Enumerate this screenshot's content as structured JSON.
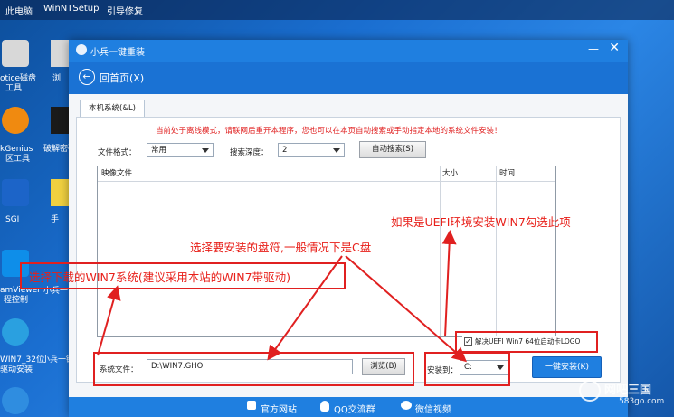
{
  "desktop": {
    "top_items": [
      "此电脑",
      "WinNTSetup",
      "引导修复"
    ],
    "icons": [
      {
        "label1": "otice磁盘",
        "label2": "工具",
        "icon": "disk-tool-icon",
        "color": "#cfcfcf"
      },
      {
        "label1": "kGenius",
        "label2": "区工具",
        "icon": "diskgenius-icon",
        "color": "#f08a10"
      },
      {
        "label1": "SGI",
        "label2": "",
        "icon": "sgi-icon",
        "color": "#1c64c8"
      },
      {
        "label1": "amViewer",
        "label2": "程控制",
        "icon": "teamviewer-icon",
        "color": "#0e8ee9"
      },
      {
        "label1": "WIN7_32位",
        "label2": "驱动安装",
        "icon": "driver-install-icon",
        "color": "#2aa0e0"
      },
      {
        "label1": "",
        "label2": "",
        "icon": "gear-tool-icon",
        "color": "#2f8de0"
      }
    ],
    "col2_labels": [
      "浏",
      "破解密码",
      "手",
      "小兵一",
      "小兵一键"
    ]
  },
  "window": {
    "title": "小兵一键重装",
    "back_label": "回首页(X)",
    "tab_label": "本机系统(&L)",
    "notice": "当前处于离线模式，请联网后重开本程序，您也可以在本页自动搜索或手动指定本地的系统文件安装！",
    "file_format_label": "文件格式：",
    "file_format_value": "常用",
    "search_depth_label": "搜索深度：",
    "search_depth_value": "2",
    "auto_search_button": "自动搜索(S)",
    "columns": [
      "映像文件",
      "大小",
      "时间"
    ],
    "uefi_checkbox_label": "解决UEFI Win7 64位启动卡LOGO",
    "system_file_label": "系统文件：",
    "system_file_value": "D:\\WIN7.GHO",
    "browse_button": "浏览(B)",
    "install_to_label": "安装到：",
    "install_to_value": "C:",
    "install_button": "一键安装(K)",
    "bottom_links": [
      "官方网站",
      "QQ交流群",
      "微信视频"
    ]
  },
  "annotations": {
    "uefi": "如果是UEFI环境安装WIN7勾选此项",
    "drive": "选择要安装的盘符,一般情况下是C盘",
    "system": "选择下载的WIN7系统(建议采用本站的WIN7带驱动)"
  },
  "watermark": {
    "text": "网吧三国",
    "site": "583go.com"
  },
  "colors": {
    "accent": "#1f7fe0",
    "annotation": "#e02020"
  }
}
